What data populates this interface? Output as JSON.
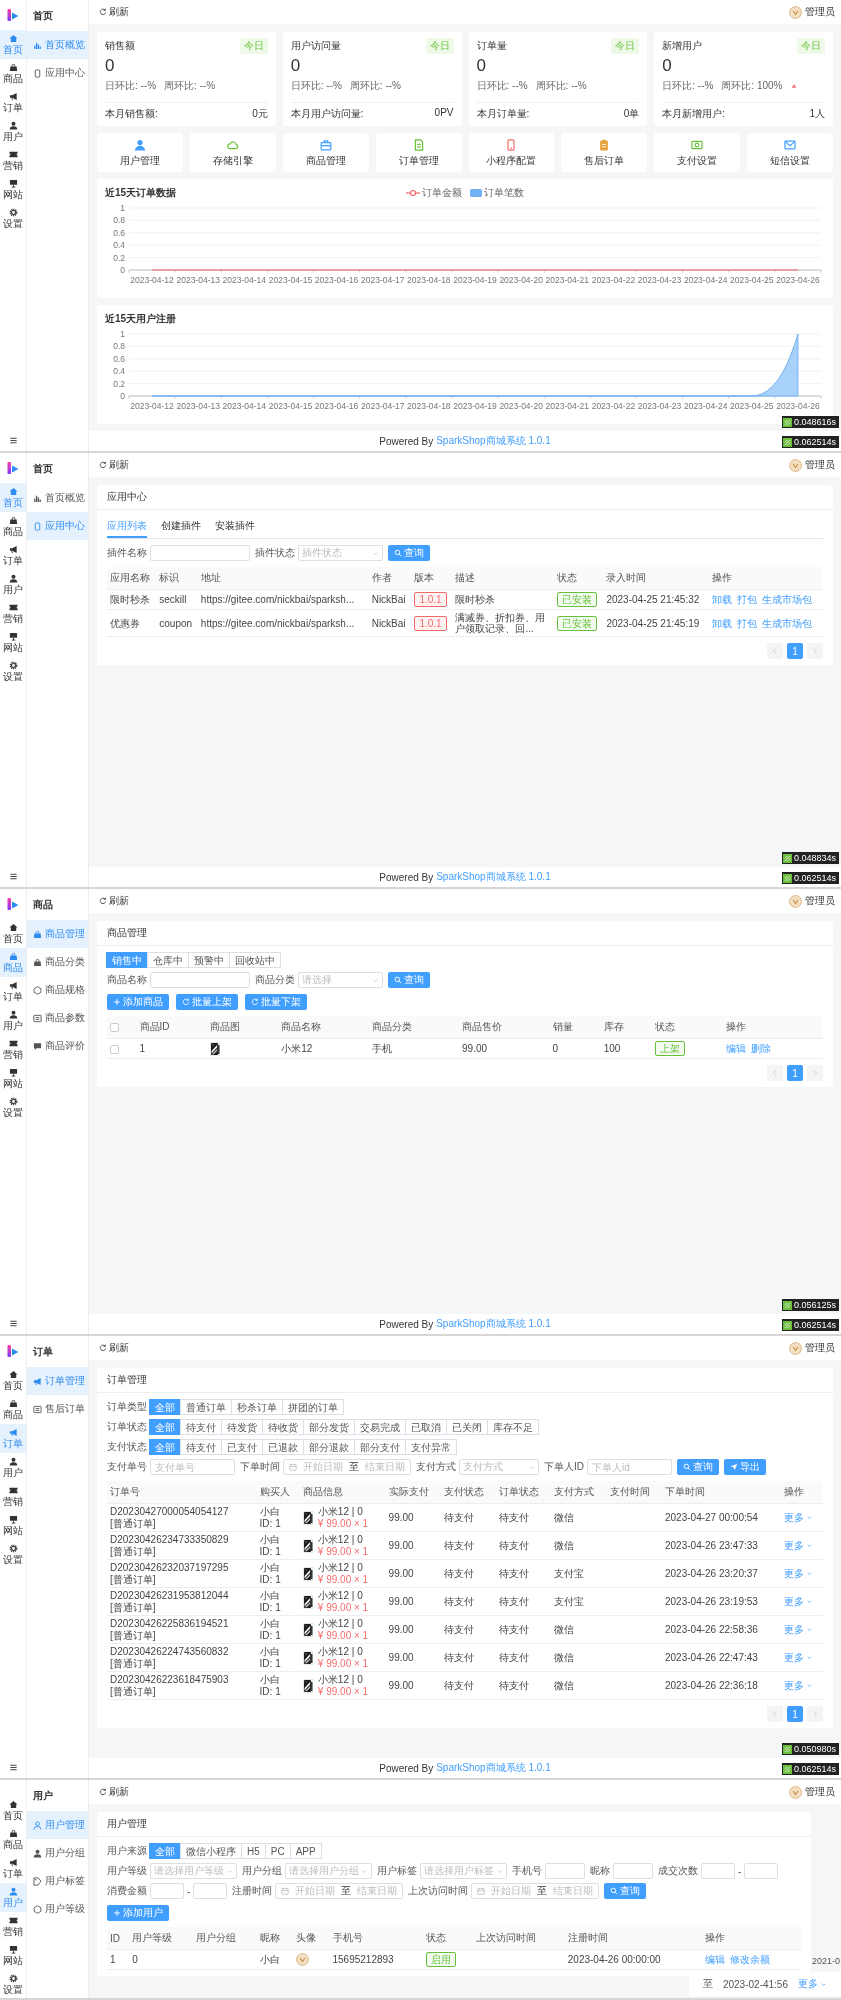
{
  "screens": [
    {
      "nav": [
        {
          "label": "首页",
          "selected": true
        },
        {
          "label": "商品",
          "selected": false
        },
        {
          "label": "订单",
          "selected": false
        },
        {
          "label": "用户",
          "selected": false
        },
        {
          "label": "营销",
          "selected": false
        },
        {
          "label": "网站",
          "selected": false
        },
        {
          "label": "设置",
          "selected": false
        }
      ],
      "submenu": {
        "title": "首页",
        "items": [
          {
            "label": "首页概览",
            "selected": true
          },
          {
            "label": "应用中心",
            "selected": false
          }
        ]
      },
      "topbar": {
        "refresh": "刷新",
        "user": "管理员"
      },
      "content": [
        {
          "kind": "stats",
          "cards": [
            {
              "title": "销售额",
              "tag": "今日",
              "value": "0",
              "day": "日环比: --%",
              "week": "周环比: --%",
              "trend_up": false,
              "month_label": "本月销售额:",
              "month_value": "0元"
            },
            {
              "title": "用户访问量",
              "tag": "今日",
              "value": "0",
              "day": "日环比: --%",
              "week": "周环比: --%",
              "trend_up": false,
              "month_label": "本月用户访问量:",
              "month_value": "0PV"
            },
            {
              "title": "订单量",
              "tag": "今日",
              "value": "0",
              "day": "日环比: --%",
              "week": "周环比: --%",
              "trend_up": false,
              "month_label": "本月订单量:",
              "month_value": "0单"
            },
            {
              "title": "新增用户",
              "tag": "今日",
              "value": "0",
              "day": "日环比: --%",
              "week": "周环比: 100%",
              "trend_up": true,
              "month_label": "本月新增用户:",
              "month_value": "1人"
            }
          ]
        },
        {
          "kind": "shortcuts",
          "items": [
            "用户管理",
            "存储引擎",
            "商品管理",
            "订单管理",
            "小程序配置",
            "售后订单",
            "支付设置",
            "短信设置"
          ]
        },
        {
          "kind": "chart",
          "chart_data": {
            "type": "line",
            "title": "近15天订单数据",
            "grid": true,
            "categories": [
              "2023-04-12",
              "2023-04-13",
              "2023-04-14",
              "2023-04-15",
              "2023-04-16",
              "2023-04-17",
              "2023-04-18",
              "2023-04-19",
              "2023-04-20",
              "2023-04-21",
              "2023-04-22",
              "2023-04-23",
              "2023-04-24",
              "2023-04-25",
              "2023-04-26"
            ],
            "ylim": [
              0,
              1
            ],
            "yticks": [
              0,
              0.2,
              0.4,
              0.6,
              0.8,
              1
            ],
            "series": [
              {
                "name": "订单金额",
                "type": "line",
                "color": "#ee6666",
                "values": [
                  0,
                  0,
                  0,
                  0,
                  0,
                  0,
                  0,
                  0,
                  0,
                  0,
                  0,
                  0,
                  0,
                  0,
                  0
                ]
              },
              {
                "name": "订单笔数",
                "type": "bar",
                "color": "#73b3f5",
                "values": [
                  0,
                  0,
                  0,
                  0,
                  0,
                  0,
                  0,
                  0,
                  0,
                  0,
                  0,
                  0,
                  0,
                  0,
                  0
                ]
              }
            ]
          }
        },
        {
          "kind": "chart",
          "chart_data": {
            "type": "area",
            "title": "近15天用户注册",
            "grid": true,
            "categories": [
              "2023-04-12",
              "2023-04-13",
              "2023-04-14",
              "2023-04-15",
              "2023-04-16",
              "2023-04-17",
              "2023-04-18",
              "2023-04-19",
              "2023-04-20",
              "2023-04-21",
              "2023-04-22",
              "2023-04-23",
              "2023-04-24",
              "2023-04-25",
              "2023-04-26"
            ],
            "ylim": [
              0,
              1
            ],
            "yticks": [
              0,
              0.2,
              0.4,
              0.6,
              0.8,
              1
            ],
            "values": [
              0,
              0,
              0,
              0,
              0,
              0,
              0,
              0,
              0,
              0,
              0,
              0,
              0,
              0,
              1
            ]
          }
        }
      ],
      "footer": {
        "text": "Powered By",
        "link": "SparkShop商城系统 1.0.1"
      },
      "timers": [
        "0.048616s",
        "0.062514s"
      ]
    },
    {
      "nav": [
        {
          "label": "首页",
          "selected": true
        },
        {
          "label": "商品",
          "selected": false
        },
        {
          "label": "订单",
          "selected": false
        },
        {
          "label": "用户",
          "selected": false
        },
        {
          "label": "营销",
          "selected": false
        },
        {
          "label": "网站",
          "selected": false
        },
        {
          "label": "设置",
          "selected": false
        }
      ],
      "submenu": {
        "title": "首页",
        "items": [
          {
            "label": "首页概览",
            "selected": false
          },
          {
            "label": "应用中心",
            "selected": true
          }
        ]
      },
      "topbar": {
        "refresh": "刷新",
        "user": "管理员"
      },
      "card": {
        "title": "应用中心",
        "blocks": [
          {
            "kind": "tabs",
            "items": [
              {
                "label": "应用列表",
                "selected": true
              },
              {
                "label": "创建插件",
                "selected": false
              },
              {
                "label": "安装插件",
                "selected": false
              }
            ]
          },
          {
            "kind": "filters",
            "rows": [
              {
                "fields": [
                  {
                    "kind": "input",
                    "label": "插件名称"
                  },
                  {
                    "kind": "select",
                    "label": "插件状态",
                    "placeholder": "插件状态"
                  },
                  {
                    "kind": "query",
                    "label": "查询"
                  }
                ]
              }
            ]
          },
          {
            "kind": "table",
            "columns": [
              "应用名称",
              "标识",
              "地址",
              "作者",
              "版本",
              "描述",
              "状态",
              "录入时间",
              "操作"
            ],
            "rows": [
              [
                "限时秒杀",
                "seckill",
                "https://gitee.com/nickbai/sparksh...",
                "NickBai",
                {
                  "kind": "tag",
                  "text": "1.0.1",
                  "color": "#f56c6c"
                },
                {
                  "kind": "desc",
                  "text": "限时秒杀"
                },
                {
                  "kind": "tag",
                  "text": "已安装",
                  "color": "#67c23a"
                },
                "2023-04-25 21:45:32",
                {
                  "kind": "links",
                  "links": [
                    "卸载",
                    "打包",
                    "生成市场包"
                  ]
                }
              ],
              [
                "优惠券",
                "coupon",
                "https://gitee.com/nickbai/sparksh...",
                "NickBai",
                {
                  "kind": "tag",
                  "text": "1.0.1",
                  "color": "#f56c6c"
                },
                {
                  "kind": "desc",
                  "text": "满减券、折扣券、用户领取记录、回..."
                },
                {
                  "kind": "tag",
                  "text": "已安装",
                  "color": "#67c23a"
                },
                "2023-04-25 21:45:19",
                {
                  "kind": "links",
                  "links": [
                    "卸载",
                    "打包",
                    "生成市场包"
                  ]
                }
              ]
            ]
          },
          {
            "kind": "pager",
            "pages": [
              {
                "label": "1",
                "selected": true
              }
            ]
          }
        ]
      },
      "footer": {
        "text": "Powered By",
        "link": "SparkShop商城系统 1.0.1"
      },
      "timers": [
        "0.048834s",
        "0.062514s"
      ]
    },
    {
      "nav": [
        {
          "label": "首页",
          "selected": false
        },
        {
          "label": "商品",
          "selected": true
        },
        {
          "label": "订单",
          "selected": false
        },
        {
          "label": "用户",
          "selected": false
        },
        {
          "label": "营销",
          "selected": false
        },
        {
          "label": "网站",
          "selected": false
        },
        {
          "label": "设置",
          "selected": false
        }
      ],
      "submenu": {
        "title": "商品",
        "items": [
          {
            "label": "商品管理",
            "selected": true
          },
          {
            "label": "商品分类",
            "selected": false
          },
          {
            "label": "商品规格",
            "selected": false
          },
          {
            "label": "商品参数",
            "selected": false
          },
          {
            "label": "商品评价",
            "selected": false
          }
        ]
      },
      "topbar": {
        "refresh": "刷新",
        "user": "管理员"
      },
      "card": {
        "title": "商品管理",
        "blocks": [
          {
            "kind": "filters",
            "rows": [
              {
                "fields": [
                  {
                    "kind": "options",
                    "options": [
                      {
                        "label": "销售中",
                        "selected": true
                      },
                      {
                        "label": "仓库中",
                        "selected": false
                      },
                      {
                        "label": "预警中",
                        "selected": false
                      },
                      {
                        "label": "回收站中",
                        "selected": false
                      }
                    ]
                  }
                ]
              },
              {
                "fields": [
                  {
                    "kind": "input",
                    "label": "商品名称"
                  },
                  {
                    "kind": "select",
                    "label": "商品分类",
                    "placeholder": "请选择"
                  },
                  {
                    "kind": "query",
                    "label": "查询"
                  }
                ]
              }
            ]
          },
          {
            "kind": "actions",
            "buttons": [
              {
                "kind": "add",
                "label": "添加商品"
              },
              {
                "kind": "batch",
                "label": "批量上架"
              },
              {
                "kind": "batch",
                "label": "批量下架"
              }
            ]
          },
          {
            "kind": "table",
            "columns": [
              {
                "kind": "check",
                "checked": false
              },
              "商品ID",
              "商品图",
              "商品名称",
              "商品分类",
              "商品售价",
              "销量",
              "库存",
              "状态",
              "操作"
            ],
            "rows": [
              [
                {
                  "kind": "check",
                  "checked": false
                },
                "1",
                {
                  "kind": "picture"
                },
                "小米12",
                "手机",
                "99.00",
                "0",
                "100",
                {
                  "kind": "tag",
                  "text": "上架",
                  "color": "#67c23a"
                },
                {
                  "kind": "links",
                  "links": [
                    "编辑",
                    "删除"
                  ]
                }
              ]
            ]
          },
          {
            "kind": "pager",
            "pages": [
              {
                "label": "1",
                "selected": true
              }
            ]
          }
        ]
      },
      "footer": {
        "text": "Powered By",
        "link": "SparkShop商城系统 1.0.1"
      },
      "timers": [
        "0.056125s",
        "0.062514s"
      ]
    },
    {
      "nav": [
        {
          "label": "首页",
          "selected": false
        },
        {
          "label": "商品",
          "selected": false
        },
        {
          "label": "订单",
          "selected": true
        },
        {
          "label": "用户",
          "selected": false
        },
        {
          "label": "营销",
          "selected": false
        },
        {
          "label": "网站",
          "selected": false
        },
        {
          "label": "设置",
          "selected": false
        }
      ],
      "submenu": {
        "title": "订单",
        "items": [
          {
            "label": "订单管理",
            "selected": true
          },
          {
            "label": "售后订单",
            "selected": false
          }
        ]
      },
      "topbar": {
        "refresh": "刷新",
        "user": "管理员"
      },
      "card": {
        "title": "订单管理",
        "blocks": [
          {
            "kind": "filters",
            "rows": [
              {
                "fields": [
                  {
                    "kind": "options",
                    "label": "订单类型",
                    "options": [
                      {
                        "label": "全部",
                        "selected": true
                      },
                      {
                        "label": "普通订单",
                        "selected": false
                      },
                      {
                        "label": "秒杀订单",
                        "selected": false
                      },
                      {
                        "label": "拼团的订单",
                        "selected": false
                      }
                    ]
                  }
                ]
              },
              {
                "fields": [
                  {
                    "kind": "options",
                    "label": "订单状态",
                    "options": [
                      {
                        "label": "全部",
                        "selected": true
                      },
                      {
                        "label": "待支付",
                        "selected": false
                      },
                      {
                        "label": "待发货",
                        "selected": false
                      },
                      {
                        "label": "待收货",
                        "selected": false
                      },
                      {
                        "label": "部分发货",
                        "selected": false
                      },
                      {
                        "label": "交易完成",
                        "selected": false
                      },
                      {
                        "label": "已取消",
                        "selected": false
                      },
                      {
                        "label": "已关闭",
                        "selected": false
                      },
                      {
                        "label": "库存不足",
                        "selected": false
                      }
                    ]
                  }
                ]
              },
              {
                "fields": [
                  {
                    "kind": "options",
                    "label": "支付状态",
                    "options": [
                      {
                        "label": "全部",
                        "selected": true
                      },
                      {
                        "label": "待支付",
                        "selected": false
                      },
                      {
                        "label": "已支付",
                        "selected": false
                      },
                      {
                        "label": "已退款",
                        "selected": false
                      },
                      {
                        "label": "部分退款",
                        "selected": false
                      },
                      {
                        "label": "部分支付",
                        "selected": false
                      },
                      {
                        "label": "支付异常",
                        "selected": false
                      }
                    ]
                  }
                ]
              },
              {
                "fields": [
                  {
                    "kind": "input",
                    "label": "支付单号",
                    "placeholder": "支付单号"
                  },
                  {
                    "kind": "daterange",
                    "label": "下单时间",
                    "start": "开始日期",
                    "separator": "至",
                    "end": "结束日期"
                  },
                  {
                    "kind": "select",
                    "label": "支付方式",
                    "placeholder": "支付方式"
                  },
                  {
                    "kind": "input",
                    "label": "下单人ID",
                    "placeholder": "下单人id"
                  },
                  {
                    "kind": "query",
                    "label": "查询"
                  },
                  {
                    "kind": "export",
                    "label": "导出"
                  }
                ]
              }
            ]
          },
          {
            "kind": "table",
            "columns": [
              "订单号",
              "购买人",
              "商品信息",
              "实际支付",
              "支付状态",
              "订单状态",
              "支付方式",
              "支付时间",
              "下单时间",
              "操作"
            ],
            "rows": [
              [
                {
                  "kind": "lines",
                  "lines": [
                    "D20230427000054054127",
                    "[普通订单]"
                  ]
                },
                {
                  "kind": "lines",
                  "lines": [
                    "小白",
                    "ID: 1"
                  ]
                },
                {
                  "kind": "product",
                  "name": "小米12 | 0",
                  "price": "¥ 99.00 × 1"
                },
                "99.00",
                "待支付",
                "待支付",
                "微信",
                null,
                "2023-04-27 00:00:54",
                {
                  "kind": "more",
                  "text": "更多"
                }
              ],
              [
                {
                  "kind": "lines",
                  "lines": [
                    "D20230426234733350829",
                    "[普通订单]"
                  ]
                },
                {
                  "kind": "lines",
                  "lines": [
                    "小白",
                    "ID: 1"
                  ]
                },
                {
                  "kind": "product",
                  "name": "小米12 | 0",
                  "price": "¥ 99.00 × 1"
                },
                "99.00",
                "待支付",
                "待支付",
                "微信",
                null,
                "2023-04-26 23:47:33",
                {
                  "kind": "more",
                  "text": "更多"
                }
              ],
              [
                {
                  "kind": "lines",
                  "lines": [
                    "D20230426232037197295",
                    "[普通订单]"
                  ]
                },
                {
                  "kind": "lines",
                  "lines": [
                    "小白",
                    "ID: 1"
                  ]
                },
                {
                  "kind": "product",
                  "name": "小米12 | 0",
                  "price": "¥ 99.00 × 1"
                },
                "99.00",
                "待支付",
                "待支付",
                "支付宝",
                null,
                "2023-04-26 23:20:37",
                {
                  "kind": "more",
                  "text": "更多"
                }
              ],
              [
                {
                  "kind": "lines",
                  "lines": [
                    "D20230426231953812044",
                    "[普通订单]"
                  ]
                },
                {
                  "kind": "lines",
                  "lines": [
                    "小白",
                    "ID: 1"
                  ]
                },
                {
                  "kind": "product",
                  "name": "小米12 | 0",
                  "price": "¥ 99.00 × 1"
                },
                "99.00",
                "待支付",
                "待支付",
                "支付宝",
                null,
                "2023-04-26 23:19:53",
                {
                  "kind": "more",
                  "text": "更多"
                }
              ],
              [
                {
                  "kind": "lines",
                  "lines": [
                    "D20230426225836194521",
                    "[普通订单]"
                  ]
                },
                {
                  "kind": "lines",
                  "lines": [
                    "小白",
                    "ID: 1"
                  ]
                },
                {
                  "kind": "product",
                  "name": "小米12 | 0",
                  "price": "¥ 99.00 × 1"
                },
                "99.00",
                "待支付",
                "待支付",
                "微信",
                null,
                "2023-04-26 22:58:36",
                {
                  "kind": "more",
                  "text": "更多"
                }
              ],
              [
                {
                  "kind": "lines",
                  "lines": [
                    "D20230426224743560832",
                    "[普通订单]"
                  ]
                },
                {
                  "kind": "lines",
                  "lines": [
                    "小白",
                    "ID: 1"
                  ]
                },
                {
                  "kind": "product",
                  "name": "小米12 | 0",
                  "price": "¥ 99.00 × 1"
                },
                "99.00",
                "待支付",
                "待支付",
                "微信",
                null,
                "2023-04-26 22:47:43",
                {
                  "kind": "more",
                  "text": "更多"
                }
              ],
              [
                {
                  "kind": "lines",
                  "lines": [
                    "D20230426223618475903",
                    "[普通订单]"
                  ]
                },
                {
                  "kind": "lines",
                  "lines": [
                    "小白",
                    "ID: 1"
                  ]
                },
                {
                  "kind": "product",
                  "name": "小米12 | 0",
                  "price": "¥ 99.00 × 1"
                },
                "99.00",
                "待支付",
                "待支付",
                "微信",
                null,
                "2023-04-26 22:36:18",
                {
                  "kind": "more",
                  "text": "更多"
                }
              ]
            ]
          },
          {
            "kind": "pager",
            "pages": [
              {
                "label": "1",
                "selected": true
              }
            ]
          }
        ]
      },
      "footer": {
        "text": "Powered By",
        "link": "SparkShop商城系统 1.0.1"
      },
      "timers": [
        "0.050980s",
        "0.062514s"
      ]
    },
    {
      "nav": [
        {
          "label": "首页",
          "selected": false
        },
        {
          "label": "商品",
          "selected": false
        },
        {
          "label": "订单",
          "selected": false
        },
        {
          "label": "用户",
          "selected": true
        },
        {
          "label": "营销",
          "selected": false
        },
        {
          "label": "网站",
          "selected": false
        },
        {
          "label": "设置",
          "selected": false
        }
      ],
      "submenu": {
        "title": "用户",
        "items": [
          {
            "label": "用户管理",
            "selected": true
          },
          {
            "label": "用户分组",
            "selected": false
          },
          {
            "label": "用户标签",
            "selected": false
          },
          {
            "label": "用户等级",
            "selected": false
          }
        ]
      },
      "topbar": {
        "refresh": "刷新",
        "user": "管理员"
      },
      "card": {
        "title": "用户管理",
        "blocks": [
          {
            "kind": "filters",
            "rows": [
              {
                "fields": [
                  {
                    "kind": "options",
                    "label": "用户来源",
                    "options": [
                      {
                        "label": "全部",
                        "selected": true
                      },
                      {
                        "label": "微信小程序",
                        "selected": false
                      },
                      {
                        "label": "H5",
                        "selected": false
                      },
                      {
                        "label": "PC",
                        "selected": false
                      },
                      {
                        "label": "APP",
                        "selected": false
                      }
                    ]
                  }
                ]
              },
              {
                "fields": [
                  {
                    "kind": "select",
                    "label": "用户等级",
                    "placeholder": "请选择用户等级"
                  },
                  {
                    "kind": "select",
                    "label": "用户分组",
                    "placeholder": "请选择用户分组"
                  },
                  {
                    "kind": "select",
                    "label": "用户标签",
                    "placeholder": "请选择用户标签"
                  },
                  {
                    "kind": "input",
                    "label": "手机号"
                  },
                  {
                    "kind": "input",
                    "label": "昵称"
                  },
                  {
                    "kind": "range",
                    "label": "成交次数",
                    "separator": "-"
                  }
                ]
              },
              {
                "fields": [
                  {
                    "kind": "range",
                    "label": "消费金额",
                    "separator": "-"
                  },
                  {
                    "kind": "daterange",
                    "label": "注册时间",
                    "start": "开始日期",
                    "separator": "至",
                    "end": "结束日期"
                  },
                  {
                    "kind": "daterange",
                    "label": "上次访问时间",
                    "start": "开始日期",
                    "separator": "至",
                    "end": "结束日期"
                  },
                  {
                    "kind": "query",
                    "label": "查询"
                  }
                ]
              }
            ]
          },
          {
            "kind": "actions",
            "buttons": [
              {
                "kind": "add",
                "label": "添加用户"
              }
            ]
          },
          {
            "kind": "table",
            "columns": [
              "ID",
              "用户等级",
              "用户分组",
              "昵称",
              "头像",
              "手机号",
              "状态",
              "上次访问时间",
              "注册时间",
              "操作"
            ],
            "rows": [
              [
                "1",
                "0",
                null,
                "小白",
                {
                  "kind": "avatar"
                },
                "15695212893",
                {
                  "kind": "tag",
                  "text": "启用",
                  "color": "#67c23a"
                },
                null,
                "2023-04-26 00:00:00",
                {
                  "kind": "links",
                  "links": [
                    "编辑",
                    "修改余额"
                  ]
                }
              ]
            ]
          }
        ]
      },
      "fragment": {
        "edge_text": "2021-0",
        "texts": [
          "至",
          "2023-02-41:56"
        ],
        "more": "更多"
      }
    }
  ]
}
